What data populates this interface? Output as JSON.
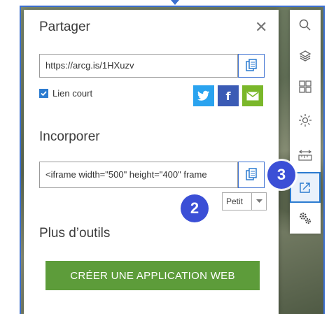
{
  "share_panel": {
    "title": "Partager",
    "close_icon": "close-icon",
    "url_value": "https://arcg.is/1HXuzv",
    "short_link_label": "Lien court",
    "short_link_checked": true,
    "social": [
      {
        "name": "twitter",
        "glyph": "🐦",
        "color": "#2aa3ef"
      },
      {
        "name": "facebook",
        "glyph": "f",
        "color": "#3b5bb5"
      },
      {
        "name": "email",
        "glyph": "✉",
        "color": "#7ab72a"
      }
    ],
    "embed_title": "Incorporer",
    "embed_value": "<iframe width=\"500\" height=\"400\" frame",
    "size_value": "Petit",
    "more_tools_title": "Plus d’outils",
    "web_app_button": "CRÉER UNE APPLICATION WEB"
  },
  "callouts": {
    "two": "2",
    "three": "3"
  },
  "toolbar": {
    "tools": [
      "search-icon",
      "layers-icon",
      "basemap-gallery-icon",
      "daylight-icon",
      "measure-icon",
      "share-icon",
      "settings-icon"
    ],
    "active": "share-icon"
  },
  "colors": {
    "accent": "#2b7bd0",
    "green_button": "#5d9c3a",
    "badge": "#3b4fd6"
  }
}
